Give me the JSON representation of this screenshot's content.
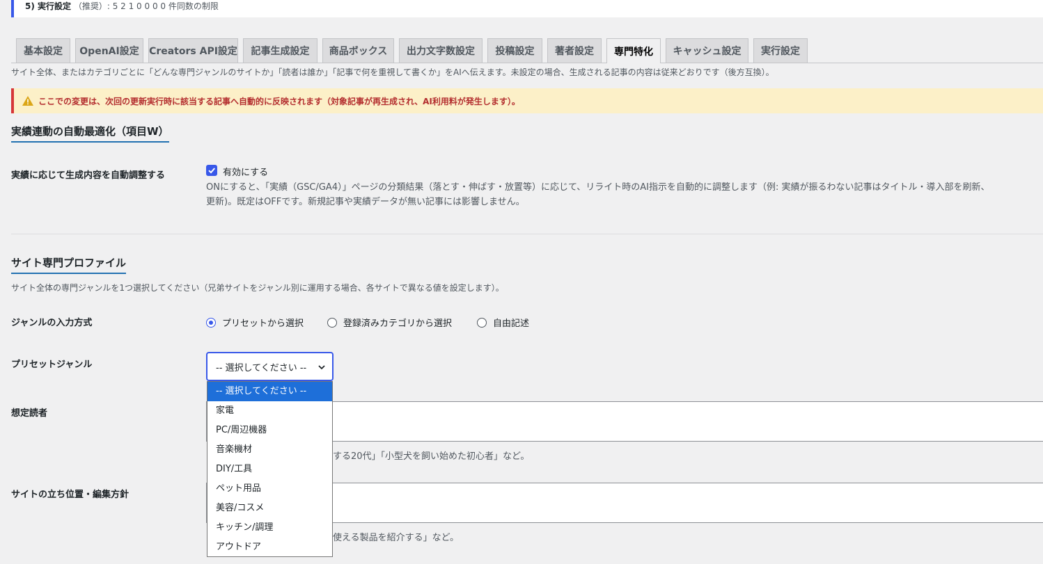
{
  "top_notice": {
    "strong": "5) 実行設定",
    "text": "（推奨）: 5 2 1 0 0 0 0 件同数の制限"
  },
  "tabs": [
    {
      "label": "基本設定"
    },
    {
      "label": "OpenAI設定"
    },
    {
      "label": "Creators API設定"
    },
    {
      "label": "記事生成設定"
    },
    {
      "label": "商品ボックス"
    },
    {
      "label": "出力文字数設定"
    },
    {
      "label": "投稿設定"
    },
    {
      "label": "著者設定"
    },
    {
      "label": "専門特化"
    },
    {
      "label": "キャッシュ設定"
    },
    {
      "label": "実行設定"
    }
  ],
  "intro": "サイト全体、またはカテゴリごとに「どんな専門ジャンルのサイトか」「読者は誰か」「記事で何を重視して書くか」をAIへ伝えます。未設定の場合、生成される記事の内容は従来どおりです（後方互換）。",
  "warning": "ここでの変更は、次回の更新実行時に該当する記事へ自動的に反映されます（対象記事が再生成され、AI利用料が発生します）。",
  "section1": {
    "title": "実績連動の自動最適化（項目W）",
    "label": "実績に応じて生成内容を自動調整する",
    "checkbox_label": "有効にする",
    "desc_line1": "ONにすると、「実績（GSC/GA4）」ページの分類結果（落とす・伸ばす・放置等）に応じて、リライト時のAI指示を自動的に調整します（例: 実績が振るわない記事はタイトル・導入部を刷新、",
    "desc_line2": "更新)。既定はOFFです。新規記事や実績データが無い記事には影響しません。"
  },
  "section2": {
    "title": "サイト専門プロファイル",
    "desc": "サイト全体の専門ジャンルを1つ選択してください（兄弟サイトをジャンル別に運用する場合、各サイトで異なる値を設定します）。",
    "genre_method_label": "ジャンルの入力方式",
    "radios": [
      {
        "label": "プリセットから選択"
      },
      {
        "label": "登録済みカテゴリから選択"
      },
      {
        "label": "自由記述"
      }
    ],
    "preset_label": "プリセットジャンル",
    "select_value": "-- 選択してください --",
    "reader_label": "想定読者",
    "reader_help": "する20代」「小型犬を飼い始めた初心者」など。",
    "stance_label": "サイトの立ち位置・編集方針",
    "stance_help": "使える製品を紹介する」など。"
  },
  "dropdown": {
    "options": [
      "-- 選択してください --",
      "家電",
      "PC/周辺機器",
      "音楽機材",
      "DIY/工具",
      "ペット用品",
      "美容/コスメ",
      "キッチン/調理",
      "アウトドア"
    ]
  },
  "colors": {
    "accent": "#3858e9",
    "warning_bg": "#fcf0c8",
    "warning_text": "#b32d2e",
    "highlight": "#1e6fd9"
  }
}
